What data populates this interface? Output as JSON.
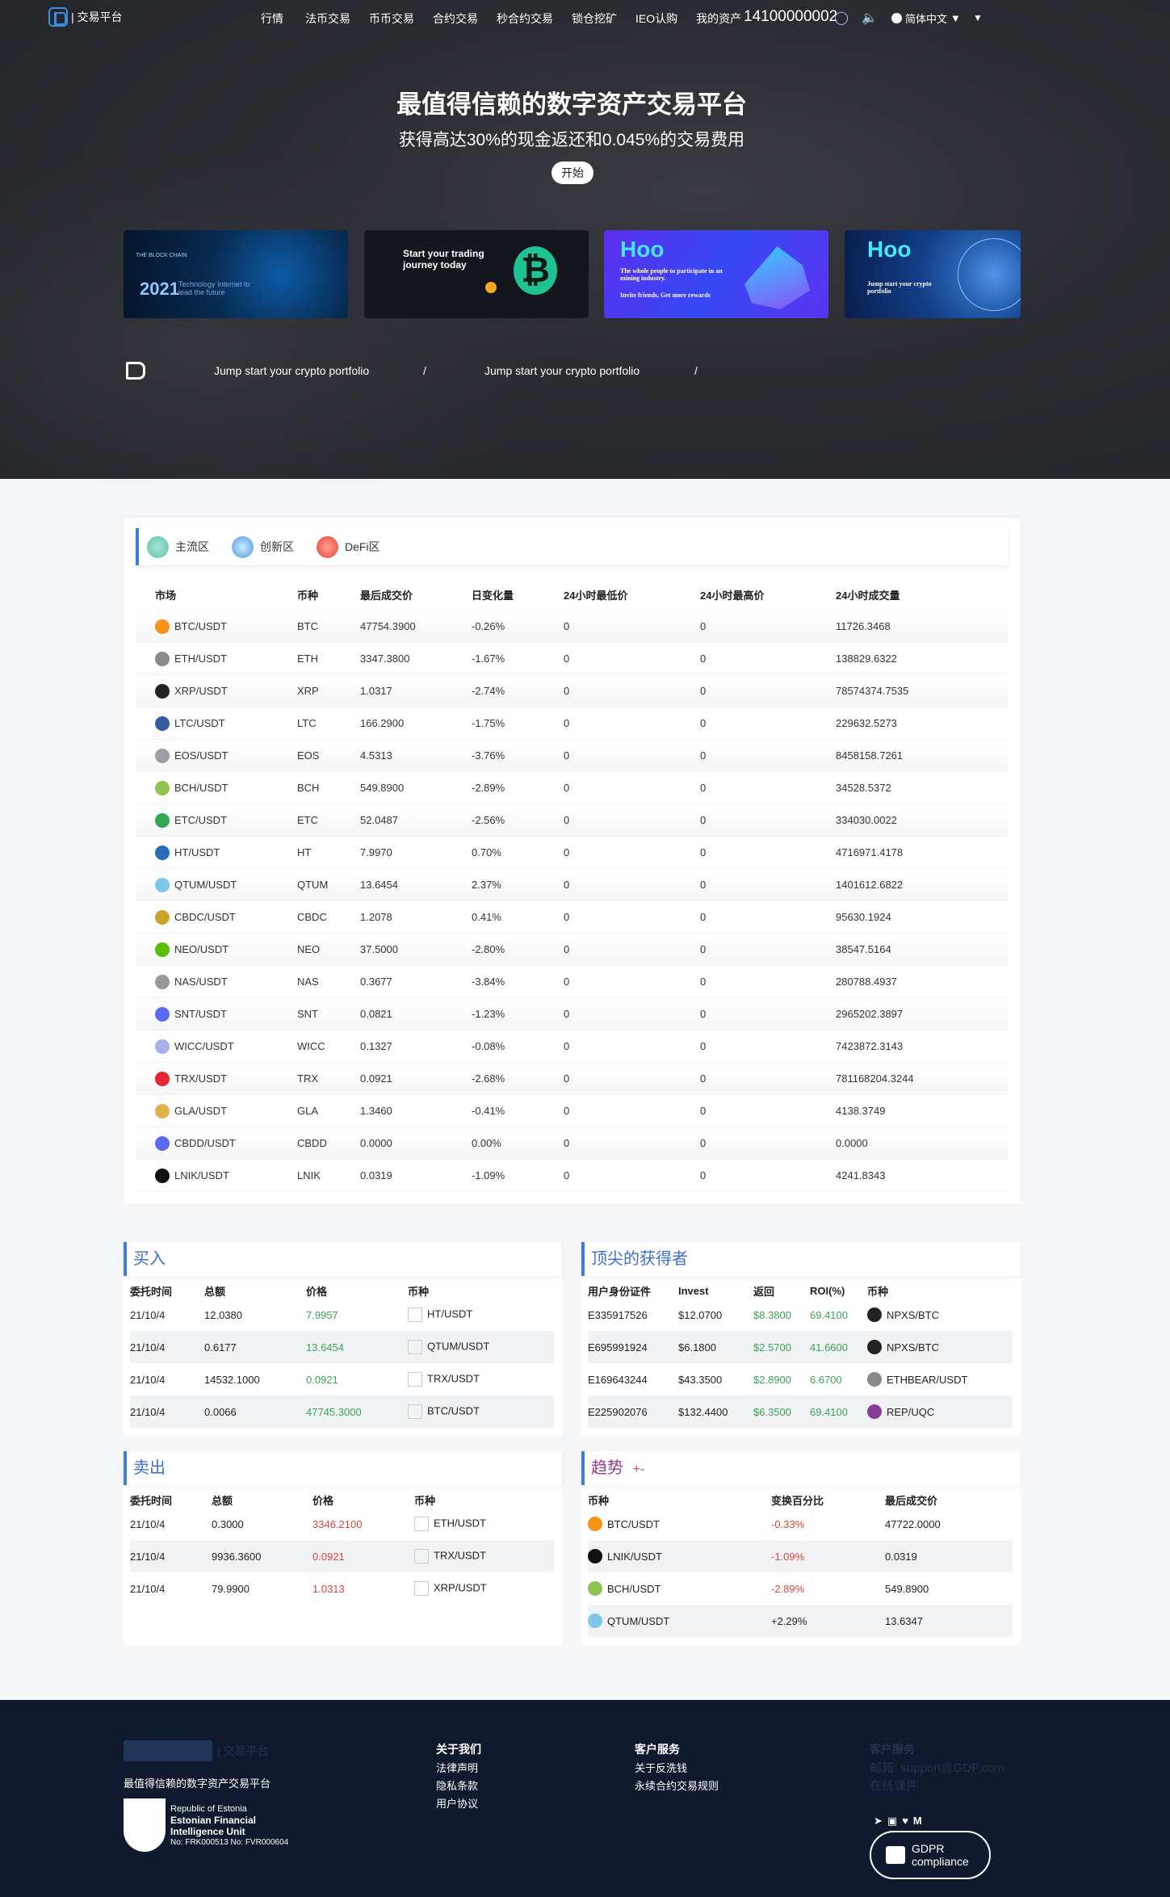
{
  "nav": {
    "logo_text": "| 交易平台",
    "links": [
      "行情",
      "法币交易",
      "币币交易",
      "合约交易",
      "秒合约交易",
      "锁仓挖矿",
      "IEO认购",
      "我的资产"
    ],
    "account": "14100000002",
    "language": "简体中文"
  },
  "hero": {
    "title": "最值得信赖的数字资产交易平台",
    "subtitle": "获得高达30%的现金返还和0.045%的交易费用",
    "start_button": "开始",
    "banners": [
      {
        "tag": "THE BLOCK CHAIN",
        "year": "2021",
        "text": "Technology Internet to lead the future"
      },
      {
        "text": "Start your trading journey today"
      },
      {
        "brand": "Hoo",
        "text": "The whole people to participate in an mining industry.",
        "sub": "Invite friends, Get more rewards"
      },
      {
        "brand": "Hoo",
        "text": "Jump start your crypto portfolio"
      }
    ],
    "ticker": [
      "Jump start your crypto portfolio",
      "/",
      "Jump start your crypto portfolio",
      "/"
    ]
  },
  "market": {
    "tabs": [
      "主流区",
      "创新区",
      "DeFi区"
    ],
    "columns": [
      "市场",
      "币种",
      "最后成交价",
      "日变化量",
      "24小时最低价",
      "24小时最高价",
      "24小时成交量"
    ],
    "rows": [
      [
        "BTC/USDT",
        "BTC",
        "47754.3900",
        "-0.26%",
        "0",
        "0",
        "11726.3468"
      ],
      [
        "ETH/USDT",
        "ETH",
        "3347.3800",
        "-1.67%",
        "0",
        "0",
        "138829.6322"
      ],
      [
        "XRP/USDT",
        "XRP",
        "1.0317",
        "-2.74%",
        "0",
        "0",
        "78574374.7535"
      ],
      [
        "LTC/USDT",
        "LTC",
        "166.2900",
        "-1.75%",
        "0",
        "0",
        "229632.5273"
      ],
      [
        "EOS/USDT",
        "EOS",
        "4.5313",
        "-3.76%",
        "0",
        "0",
        "8458158.7261"
      ],
      [
        "BCH/USDT",
        "BCH",
        "549.8900",
        "-2.89%",
        "0",
        "0",
        "34528.5372"
      ],
      [
        "ETC/USDT",
        "ETC",
        "52.0487",
        "-2.56%",
        "0",
        "0",
        "334030.0022"
      ],
      [
        "HT/USDT",
        "HT",
        "7.9970",
        "0.70%",
        "0",
        "0",
        "4716971.4178"
      ],
      [
        "QTUM/USDT",
        "QTUM",
        "13.6454",
        "2.37%",
        "0",
        "0",
        "1401612.6822"
      ],
      [
        "CBDC/USDT",
        "CBDC",
        "1.2078",
        "0.41%",
        "0",
        "0",
        "95630.1924"
      ],
      [
        "NEO/USDT",
        "NEO",
        "37.5000",
        "-2.80%",
        "0",
        "0",
        "38547.5164"
      ],
      [
        "NAS/USDT",
        "NAS",
        "0.3677",
        "-3.84%",
        "0",
        "0",
        "280788.4937"
      ],
      [
        "SNT/USDT",
        "SNT",
        "0.0821",
        "-1.23%",
        "0",
        "0",
        "2965202.3897"
      ],
      [
        "WICC/USDT",
        "WICC",
        "0.1327",
        "-0.08%",
        "0",
        "0",
        "7423872.3143"
      ],
      [
        "TRX/USDT",
        "TRX",
        "0.0921",
        "-2.68%",
        "0",
        "0",
        "781168204.3244"
      ],
      [
        "GLA/USDT",
        "GLA",
        "1.3460",
        "-0.41%",
        "0",
        "0",
        "4138.3749"
      ],
      [
        "CBDD/USDT",
        "CBDD",
        "0.0000",
        "0.00%",
        "0",
        "0",
        "0.0000"
      ],
      [
        "LNIK/USDT",
        "LNIK",
        "0.0319",
        "-1.09%",
        "0",
        "0",
        "4241.8343"
      ]
    ],
    "coin_colors": [
      "#f7931a",
      "#8a8a8a",
      "#222222",
      "#345d9d",
      "#9aa0a6",
      "#8dc351",
      "#33a853",
      "#2b6cb8",
      "#7fc7e8",
      "#c9a227",
      "#58bf00",
      "#999999",
      "#5b6bf0",
      "#a8b0f0",
      "#e6262e",
      "#e0b24a",
      "#5b6bf0",
      "#111111"
    ]
  },
  "buy": {
    "title": "买入",
    "columns": [
      "委托时间",
      "总额",
      "价格",
      "币种"
    ],
    "rows": [
      [
        "21/10/4",
        "12.0380",
        "7.9957",
        "HT/USDT"
      ],
      [
        "21/10/4",
        "0.6177",
        "13.6454",
        "QTUM/USDT"
      ],
      [
        "21/10/4",
        "14532.1000",
        "0.0921",
        "TRX/USDT"
      ],
      [
        "21/10/4",
        "0.0066",
        "47745.3000",
        "BTC/USDT"
      ]
    ]
  },
  "top": {
    "title": "顶尖的获得者",
    "columns": [
      "用户身份证件",
      "Invest",
      "返回",
      "ROI(%)",
      "币种"
    ],
    "rows": [
      [
        "E335917526",
        "$12.0700",
        "$8.3800",
        "69.4100",
        "NPXS/BTC"
      ],
      [
        "E695991924",
        "$6.1800",
        "$2.5700",
        "41.6600",
        "NPXS/BTC"
      ],
      [
        "E169643244",
        "$43.3500",
        "$2.8900",
        "6.6700",
        "ETHBEAR/USDT"
      ],
      [
        "E225902076",
        "$132.4400",
        "$6.3500",
        "69.4100",
        "REP/UQC"
      ]
    ]
  },
  "sell": {
    "title": "卖出",
    "columns": [
      "委托时间",
      "总额",
      "价格",
      "币种"
    ],
    "rows": [
      [
        "21/10/4",
        "0.3000",
        "3346.2100",
        "ETH/USDT"
      ],
      [
        "21/10/4",
        "9936.3600",
        "0.0921",
        "TRX/USDT"
      ],
      [
        "21/10/4",
        "79.9900",
        "1.0313",
        "XRP/USDT"
      ]
    ]
  },
  "trend": {
    "title": "趋势",
    "suffix": "+-",
    "columns": [
      "币种",
      "变换百分比",
      "最后成交价"
    ],
    "rows": [
      [
        "BTC/USDT",
        "-0.33%",
        "47722.0000"
      ],
      [
        "LNIK/USDT",
        "-1.09%",
        "0.0319"
      ],
      [
        "BCH/USDT",
        "-2.89%",
        "549.8900"
      ],
      [
        "QTUM/USDT",
        "+2.29%",
        "13.6347"
      ]
    ]
  },
  "footer": {
    "logo_text": "| 交易平台",
    "tagline": "最值得信赖的数字资产交易平台",
    "estonia": [
      "Republic of Estonia",
      "Estonian Financial",
      "Intelligence Unit",
      "No: FRK000513 No: FVR000604"
    ],
    "about_title": "关于我们",
    "about_links": [
      "法律声明",
      "隐私条款",
      "用户协议"
    ],
    "service_title": "客户服务",
    "service_links": [
      "关于反洗钱",
      "永续合约交易规则"
    ],
    "contact_title": "客户服务",
    "contact_lines": [
      "邮箱: support@GDP.com",
      "在线课件"
    ],
    "gdpr": [
      "GDPR",
      "compliance"
    ]
  }
}
